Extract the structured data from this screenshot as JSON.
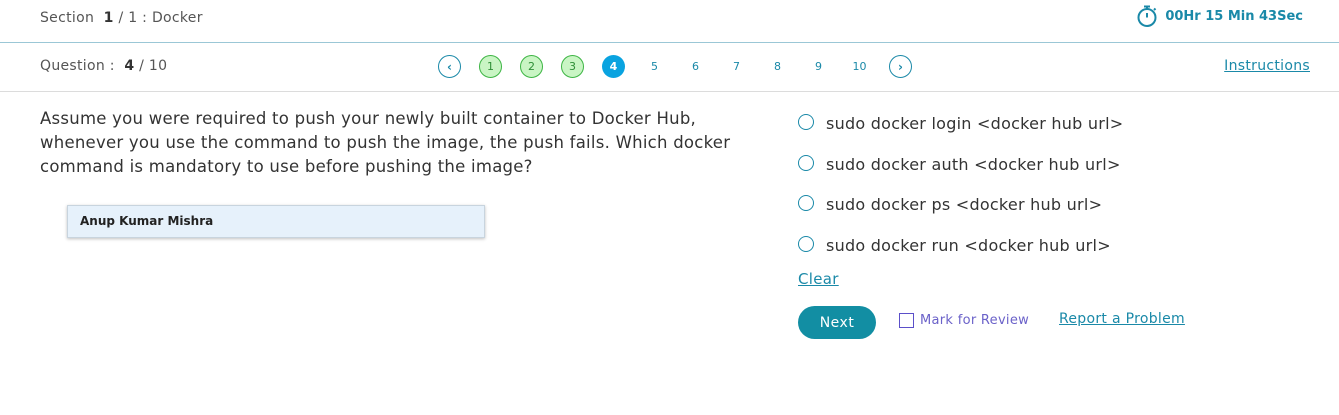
{
  "header": {
    "section_prefix": "Section",
    "section_current": "1",
    "section_rest": "/ 1 : Docker",
    "timer_text": "00Hr 15 Min 43Sec"
  },
  "question_bar": {
    "question_prefix": "Question :",
    "question_current": "4",
    "question_total": "/ 10",
    "prev_icon": "chevron-left-icon",
    "next_icon": "chevron-right-icon",
    "pages": [
      {
        "label": "1",
        "state": "answered"
      },
      {
        "label": "2",
        "state": "answered"
      },
      {
        "label": "3",
        "state": "answered"
      },
      {
        "label": "4",
        "state": "current"
      },
      {
        "label": "5",
        "state": "unvisited"
      },
      {
        "label": "6",
        "state": "unvisited"
      },
      {
        "label": "7",
        "state": "unvisited"
      },
      {
        "label": "8",
        "state": "unvisited"
      },
      {
        "label": "9",
        "state": "unvisited"
      },
      {
        "label": "10",
        "state": "unvisited"
      }
    ],
    "instructions_label": "Instructions"
  },
  "question": {
    "text": "Assume you were required to push your newly built container to Docker Hub, whenever you use the command to push the image, the push fails. Which docker command is mandatory to use before pushing the image?",
    "watermark_name": "Anup Kumar Mishra"
  },
  "options": [
    "sudo docker login <docker hub url>",
    "sudo docker auth <docker hub url>",
    "sudo docker ps <docker hub url>",
    "sudo docker run <docker hub url>"
  ],
  "actions": {
    "clear_label": "Clear",
    "next_label": "Next",
    "mark_review_label": "Mark for Review",
    "report_label": "Report a Problem"
  },
  "colors": {
    "accent": "#1a89a8",
    "current_page": "#09a3e0",
    "answered_fill": "#c9f5c4",
    "answered_border": "#3db544",
    "next_button": "#128ea3",
    "review": "#5b4fc9"
  }
}
